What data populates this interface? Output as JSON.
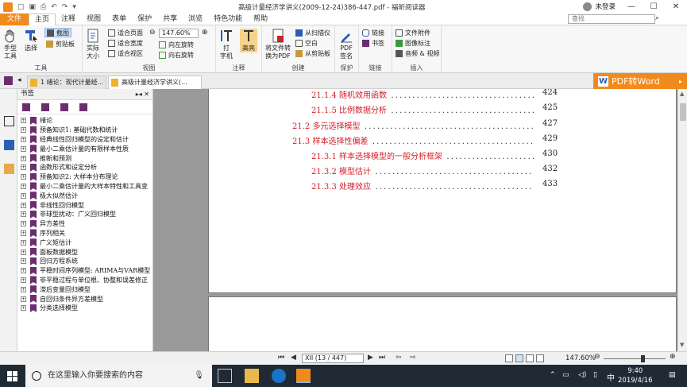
{
  "titlebar": {
    "title": "高级计量经济学讲义(2009-12-24)386-447.pdf - 福昕阅读器",
    "user": "未登录"
  },
  "ribbon_tabs": [
    "文件",
    "主页",
    "注释",
    "视图",
    "表单",
    "保护",
    "共享",
    "浏览",
    "特色功能",
    "帮助"
  ],
  "search": {
    "placeholder": "查找"
  },
  "ribbon": {
    "tools": {
      "hand": "手型\n工具",
      "select": "选择",
      "snapshot": "截图",
      "clipboard": "剪贴板",
      "label": "工具"
    },
    "view": {
      "actual": "实际\n大小",
      "fit_page": "适合页面",
      "fit_width": "适合宽度",
      "fit_visible": "适合视区",
      "zoom": "147.60%",
      "rotate_left": "向左旋转",
      "rotate_right": "向右旋转",
      "label": "视图"
    },
    "comment": {
      "typewriter": "打\n字机",
      "highlight": "高亮",
      "label": "注释"
    },
    "create": {
      "to_pdf": "将文件转\n换为PDF",
      "from_scanner": "从扫描仪",
      "blank": "空白",
      "from_clipboard": "从剪贴板",
      "label": "创建"
    },
    "protect": {
      "sign": "PDF\n签名",
      "label": "保护"
    },
    "links": {
      "link": "链接",
      "bookmark": "书签",
      "label": "链接"
    },
    "insert": {
      "attachment": "文件附件",
      "image": "图像标注",
      "media": "音频 & 视频",
      "label": "插入"
    }
  },
  "doc_tabs": [
    "1 绪论：现代计量经...",
    "高级计量经济学讲义(..."
  ],
  "pdf2word": "PDF转Word",
  "bookmarks": {
    "title": "书签",
    "items": [
      "绪论",
      "预备知识1: 基础代数和统计",
      "经典线性回归模型的设定和估计",
      "最小二乘估计量的有限样本性质",
      "推断和预测",
      "函数形式和设定分析",
      "预备知识2: 大样本分布理论",
      "最小二乘估计量的大样本特性和工具变",
      "极大似然估计",
      "非线性回归模型",
      "非球型扰动：广义回归模型",
      "异方差性",
      "序列相关",
      "广义矩估计",
      "面板数据模型",
      "回归方程系统",
      "平稳时间序列模型: ARIMA与VAR模型",
      "非平稳过程与单位根、协整和误差修正",
      "滞后变量回归模型",
      "自回归条件异方差模型",
      "分类选择模型"
    ]
  },
  "toc": [
    {
      "num": "21.1.4",
      "title": "随机效用函数",
      "page": "424"
    },
    {
      "num": "21.1.5",
      "title": "比例数据分析",
      "page": "425"
    },
    {
      "num": "21.2",
      "title": "多元选择模型",
      "page": "427"
    },
    {
      "num": "21.3",
      "title": "样本选择性偏差",
      "page": "429"
    },
    {
      "num": "21.3.1",
      "title": "样本选择模型的一般分析框架",
      "page": "430"
    },
    {
      "num": "21.3.2",
      "title": "模型估计",
      "page": "432"
    },
    {
      "num": "21.3.3",
      "title": "处理效应",
      "page": "433"
    }
  ],
  "statusbar": {
    "page": "XII (13 / 447)",
    "zoom": "147.60%"
  },
  "taskbar": {
    "search": "在这里输入你要搜索的内容",
    "time": "9:40",
    "date": "2019/4/16",
    "ime": "中"
  }
}
